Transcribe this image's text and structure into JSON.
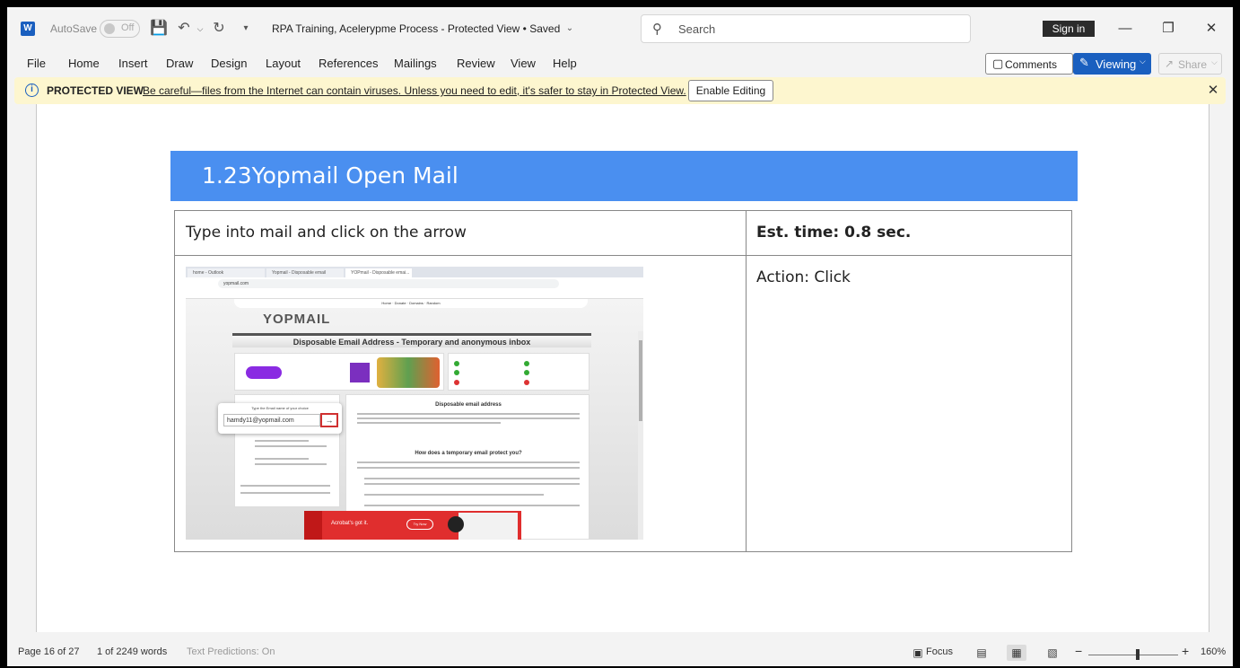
{
  "app": {
    "logo_letter": "W",
    "autosave_label": "AutoSave",
    "autosave_state": "Off",
    "document_title": "RPA Training, Acelerypme Process  -  Protected View • Saved",
    "search_placeholder": "Search",
    "sign_in": "Sign in"
  },
  "menu": {
    "items": [
      "File",
      "Home",
      "Insert",
      "Draw",
      "Design",
      "Layout",
      "References",
      "Mailings",
      "Review",
      "View",
      "Help"
    ],
    "comments": "Comments",
    "viewing": "Viewing",
    "share": "Share"
  },
  "protected": {
    "title": "PROTECTED VIEW",
    "message": "Be careful—files from the Internet can contain viruses. Unless you need to edit, it's safer to stay in Protected View.",
    "enable_button": "Enable Editing"
  },
  "document": {
    "heading": "1.23Yopmail Open Mail",
    "step_description": "Type into mail and click on the arrow",
    "est_time": "Est. time: 0.8 sec.",
    "action": "Action: Click"
  },
  "screenshot": {
    "tabs": [
      "home - Outlook",
      "Yopmail - Disposable email",
      "YOPmail - Disposable emai..."
    ],
    "url": "yopmail.com",
    "logo": "YOPMAIL",
    "nav": "Home  ·  Donate  ·  Domains  ·  Random",
    "header": "Disposable Email Address - Temporary and anonymous inbox",
    "email_label": "Type the Email name of your choice",
    "email_value": "hamdy11@yopmail.com",
    "arrow": "→",
    "right_heading": "Disposable email address",
    "right_heading2": "How does a temporary email protect you?",
    "ad_text": "Acrobat's got it.",
    "ad_button": "Try Now"
  },
  "status": {
    "page": "Page 16 of 27",
    "words": "1 of 2249 words",
    "predictions": "Text Predictions: On",
    "focus": "Focus",
    "zoom": "160%"
  },
  "colors": {
    "heading_bar": "#4a8ff0",
    "word_blue": "#1a5fbf",
    "protected_bg": "#fdf6cf"
  }
}
